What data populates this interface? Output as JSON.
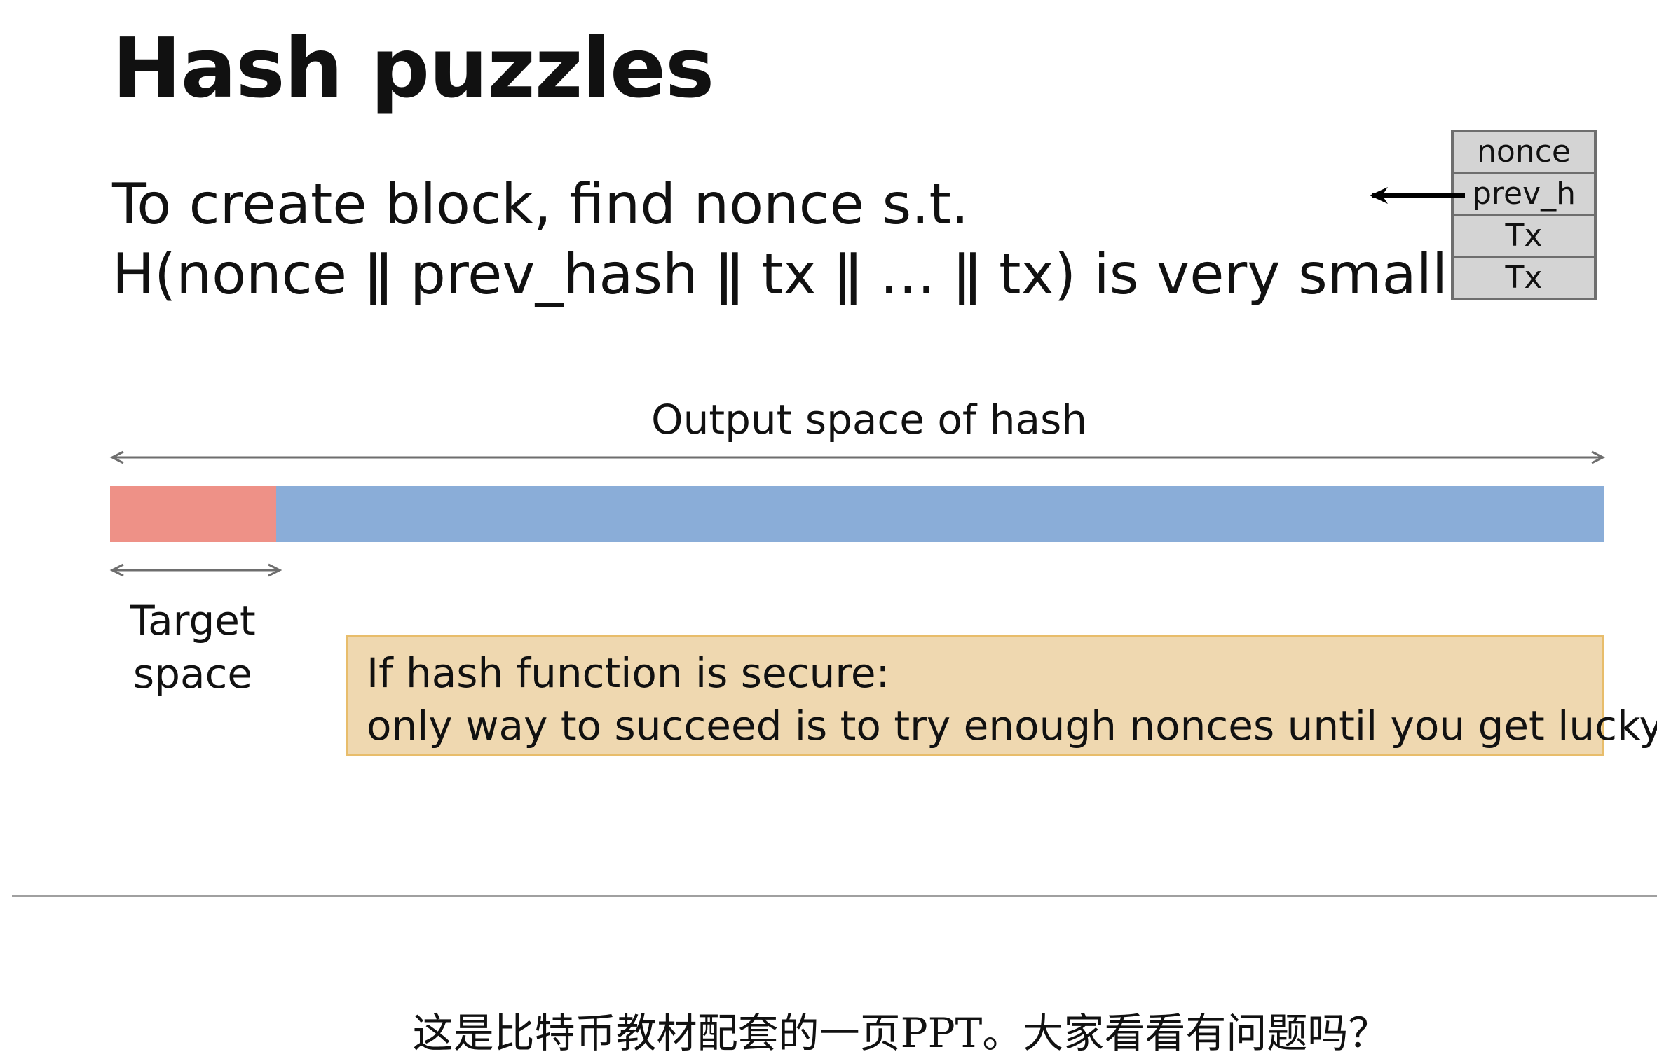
{
  "slide": {
    "title": "Hash puzzles",
    "line1": "To create block, find nonce s.t.",
    "line2": "H(nonce  ǁ  prev_hash  ǁ  tx  ǁ  …  ǁ  tx) is very small",
    "block_fields": [
      "nonce",
      "prev_h",
      "Tx",
      "Tx"
    ],
    "output_space_label": "Output space of hash",
    "target_space_label": "Target space",
    "callout_line1": "If hash function is secure:",
    "callout_line2": "only way to succeed is to try enough nonces until you get lucky",
    "colors": {
      "target": "#ee9187",
      "output": "#8aadd8",
      "callout_bg": "#efd8b0",
      "callout_border": "#e8bd6b"
    }
  },
  "caption": "这是比特币教材配套的一页PPT。大家看看有问题吗？"
}
